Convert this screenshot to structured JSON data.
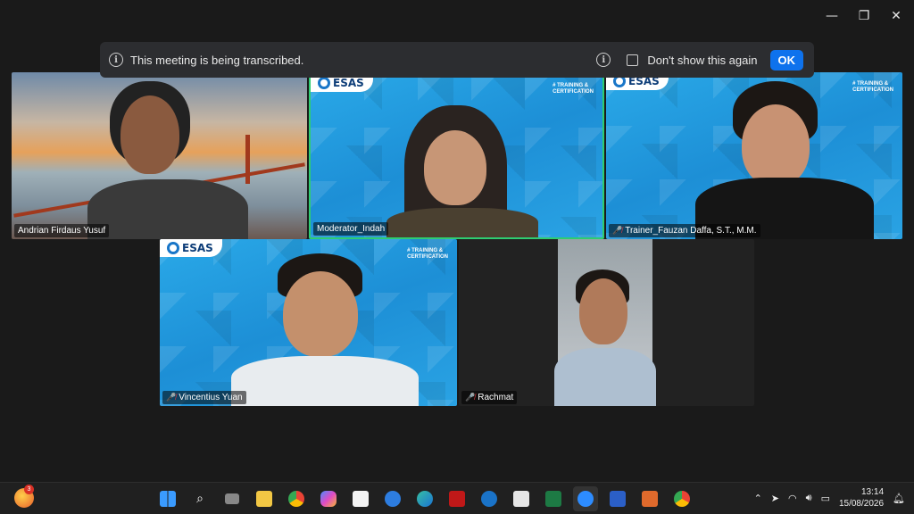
{
  "window": {
    "minimize": "—",
    "restore": "❐",
    "close": "✕"
  },
  "banner": {
    "message": "This meeting is being transcribed.",
    "checkbox_label": "Don't show this again",
    "ok_label": "OK"
  },
  "brand": {
    "logo": "ESAS",
    "tag_line1": "# TRAINING &",
    "tag_line2": "CERTIFICATION"
  },
  "participants": [
    {
      "name": "Andrian Firdaus Yusuf",
      "muted": false
    },
    {
      "name": "Moderator_Indah",
      "muted": false
    },
    {
      "name": "Trainer_Fauzan Daffa, S.T., M.M.",
      "muted": true
    },
    {
      "name": "Vincentius Yuan",
      "muted": true
    },
    {
      "name": "Rachmat",
      "muted": true
    }
  ],
  "taskbar": {
    "notification_count": "3",
    "apps": [
      "windows-start",
      "search",
      "task-view",
      "file-explorer",
      "chrome",
      "copilot",
      "microsoft-store",
      "help",
      "edge",
      "mcafee",
      "hp",
      "calendar",
      "excel",
      "zoom",
      "word",
      "media-player",
      "chrome-profile"
    ],
    "time": "13:14",
    "date": "15/08/2026"
  },
  "colors": {
    "accent": "#0e72ed",
    "active_speaker": "#2ecc71"
  }
}
